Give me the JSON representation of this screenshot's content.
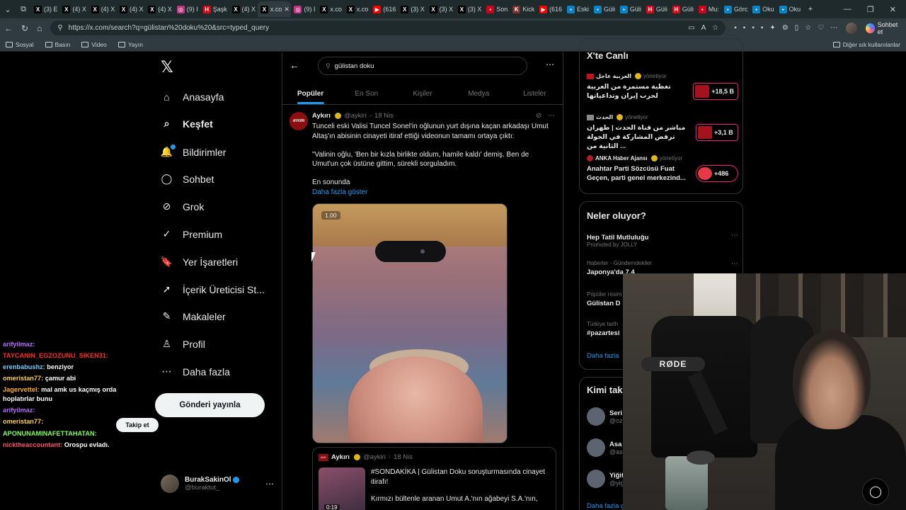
{
  "browser": {
    "tabs": [
      {
        "label": "(3) E",
        "fav": "X",
        "color": "#000000"
      },
      {
        "label": "(4) X",
        "fav": "X",
        "color": "#000000"
      },
      {
        "label": "(4) X",
        "fav": "X",
        "color": "#000000"
      },
      {
        "label": "(4) X",
        "fav": "X",
        "color": "#000000"
      },
      {
        "label": "(4) X",
        "fav": "X",
        "color": "#000000"
      },
      {
        "label": "(9) I",
        "fav": "◎",
        "color": "#c13584"
      },
      {
        "label": "Şaşk",
        "fav": "H",
        "color": "#e3061a"
      },
      {
        "label": "(4) X",
        "fav": "X",
        "color": "#000000"
      },
      {
        "label": "x.co",
        "fav": "X",
        "color": "#000000",
        "active": true
      },
      {
        "label": "(9) I",
        "fav": "◎",
        "color": "#c13584"
      },
      {
        "label": "x.co",
        "fav": "X",
        "color": "#000000"
      },
      {
        "label": "x.co",
        "fav": "X",
        "color": "#000000"
      },
      {
        "label": "(616",
        "fav": "▶",
        "color": "#ff0000"
      },
      {
        "label": "(3) X",
        "fav": "X",
        "color": "#000000"
      },
      {
        "label": "(3) X",
        "fav": "X",
        "color": "#000000"
      },
      {
        "label": "(3) X",
        "fav": "X",
        "color": "#000000"
      },
      {
        "label": "Son",
        "fav": "▪",
        "color": "#d0021b"
      },
      {
        "label": "Kick",
        "fav": "K",
        "color": "#7a2f2f"
      },
      {
        "label": "(616",
        "fav": "▶",
        "color": "#ff0000"
      },
      {
        "label": "Eski",
        "fav": "▪",
        "color": "#0a84c6"
      },
      {
        "label": "Güli",
        "fav": "▪",
        "color": "#0a84c6"
      },
      {
        "label": "Güli",
        "fav": "▪",
        "color": "#0a84c6"
      },
      {
        "label": "Güli",
        "fav": "H",
        "color": "#e3061a"
      },
      {
        "label": "Güli",
        "fav": "H",
        "color": "#e3061a"
      },
      {
        "label": "Mu:",
        "fav": "▪",
        "color": "#d0021b"
      },
      {
        "label": "Görc",
        "fav": "▪",
        "color": "#0a84c6"
      },
      {
        "label": "Oku",
        "fav": "▪",
        "color": "#0a84c6"
      },
      {
        "label": "Oku",
        "fav": "▪",
        "color": "#0a84c6"
      }
    ],
    "url": "https://x.com/search?q=gülistan%20doku%20&src=typed_query",
    "copilot_label": "Sohbet et",
    "bookmarks": [
      "Sosyal",
      "Basın",
      "Video",
      "Yayın"
    ],
    "other_bookmarks": "Diğer sık kullanılanlar"
  },
  "nav": {
    "items": [
      {
        "label": "Anasayfa",
        "icon": "home-icon",
        "glyph": "⌂"
      },
      {
        "label": "Keşfet",
        "icon": "search-icon",
        "glyph": "⌕",
        "bold": true
      },
      {
        "label": "Bildirimler",
        "icon": "bell-icon",
        "glyph": "🔔",
        "dot": true
      },
      {
        "label": "Sohbet",
        "icon": "chat-icon",
        "glyph": "◯"
      },
      {
        "label": "Grok",
        "icon": "grok-icon",
        "glyph": "⊘"
      },
      {
        "label": "Premium",
        "icon": "premium-icon",
        "glyph": "✓"
      },
      {
        "label": "Yer İşaretleri",
        "icon": "bookmark-icon",
        "glyph": "🔖"
      },
      {
        "label": "İçerik Üreticisi St...",
        "icon": "rocket-icon",
        "glyph": "➚"
      },
      {
        "label": "Makaleler",
        "icon": "article-icon",
        "glyph": "✎"
      },
      {
        "label": "Profil",
        "icon": "person-icon",
        "glyph": "♙"
      },
      {
        "label": "Daha fazla",
        "icon": "more-circle-icon",
        "glyph": "⋯"
      }
    ],
    "post_button": "Gönderi yayınla",
    "account": {
      "name": "BurakSakinOl",
      "handle": "@buraktut_"
    }
  },
  "chat": [
    {
      "user": "arifyilmaz:",
      "text": "",
      "color": "#b86cff"
    },
    {
      "user": "TAYCANIN_EGZOZUNU_SIKEN31:",
      "text": "",
      "color": "#ff2a2a"
    },
    {
      "user": "erenbabushz:",
      "text": "benziyor",
      "color": "#6fd0ff"
    },
    {
      "user": "omeristan77:",
      "text": "çamur abi",
      "color": "#ffd23f"
    },
    {
      "user": "Jagervettel:",
      "text": "mal amk us kaçmış orda hoplatırlar bunu",
      "color": "#ffb02e"
    },
    {
      "user": "arifyilmaz:",
      "text": "",
      "color": "#b86cff"
    },
    {
      "user": "omeristan77:",
      "text": "",
      "color": "#ffd23f"
    },
    {
      "user": "APONUNAMINAFETTAHATAN:",
      "text": "",
      "color": "#7dff5a"
    },
    {
      "user": "nicktheaccountant:",
      "text": "Orospu evladı.",
      "color": "#ff4e6a"
    }
  ],
  "search": {
    "value": "gülistan doku"
  },
  "tabs": [
    {
      "label": "Popüler",
      "active": true
    },
    {
      "label": "En Son"
    },
    {
      "label": "Kişiler"
    },
    {
      "label": "Medya"
    },
    {
      "label": "Listeler"
    }
  ],
  "post": {
    "avatar_text": "AYKIRI",
    "name": "Aykırı",
    "handle": "@aykiri",
    "time": "18 Nis",
    "p1": "Tunceli eski Valisi Tuncel Sonel'in oğlunun yurt dışına kaçan arkadaşı Umut Altaş'ın abisinin cinayeti itiraf ettiği videonun tamamı ortaya çıktı:",
    "p2": "\"Valinin oğlu, 'Ben bir kızla birlikte oldum, hamile kaldı' demiş. Ben de Umut'un çok üstüne gittim, sürekli sorguladım.",
    "p3": "En sonunda",
    "show_more": "Daha fazla göster",
    "video_speed": "1.00"
  },
  "quote": {
    "name": "Aykırı",
    "handle": "@aykiri",
    "time": "18 Nis",
    "duration": "0:19",
    "p1": "#SONDAKİKA | Gülistan Doku soruşturmasında cinayet itirafı!",
    "p2": "Kırmızı bültenle aranan Umut A.'nın ağabeyi S.A.'nın,"
  },
  "live": {
    "title": "X'te Canlı",
    "items": [
      {
        "source": "العربية عاجل",
        "role": "yönetiyor",
        "title": "تغطية مستمرة من العربية لحرب إيران وتداعياتها",
        "count": "+18,5 B"
      },
      {
        "source": "الحدث",
        "role": "yönetiyor",
        "title": "مباشر من قناة الحدث | طهران ترفض المشاركة في الجولة الثانية من ...",
        "count": "+3,1 B"
      },
      {
        "source": "ANKA Haber Ajansı",
        "role": "yönetiyor",
        "title": "Anahtar Parti Sözcüsü Fuat Geçen, parti genel merkezind...",
        "count": "+486"
      }
    ]
  },
  "trends": {
    "title": "Neler oluyor?",
    "items": [
      {
        "context": "",
        "name": "Hep Tatil Mutluluğu",
        "promoted": "Promoted by JOLLY"
      },
      {
        "context": "Haberler · Gündemdekiler",
        "name": "Japonya'da 7.4"
      },
      {
        "context": "Popüler resim",
        "name": "Gülistan D"
      },
      {
        "context": "Türkiye tarih",
        "name": "#pazartesi"
      }
    ],
    "show_more": "Daha fazla"
  },
  "follow": {
    "title": "Kimi tak",
    "items": [
      {
        "name": "Seri",
        "handle": "@oz"
      },
      {
        "name": "Asa",
        "handle": "@as"
      },
      {
        "name": "Yiğitcan Önal",
        "handle": "@yigitcanonal8"
      }
    ],
    "follow_button": "Takip et",
    "show_more": "Daha fazla göster"
  },
  "cam": {
    "mic_brand": "RØDE"
  }
}
